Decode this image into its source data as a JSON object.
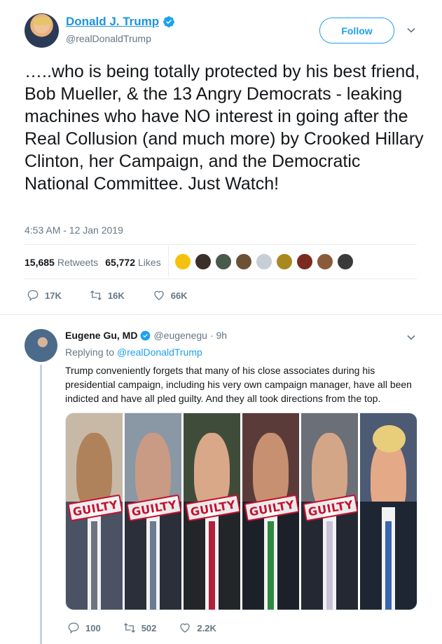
{
  "tweet": {
    "author_name": "Donald J. Trump",
    "handle": "@realDonaldTrump",
    "follow_label": "Follow",
    "text": "…..who is being totally protected by his best friend, Bob Mueller, & the 13 Angry Democrats - leaking machines who have NO interest in going after the Real Collusion (and much more) by Crooked Hillary Clinton, her Campaign, and the Democratic National Committee. Just Watch!",
    "timestamp": "4:53 AM - 12 Jan 2019",
    "retweets_count": "15,685",
    "retweets_label": "Retweets",
    "likes_count": "65,772",
    "likes_label": "Likes",
    "actions": {
      "replies": "17K",
      "retweets": "16K",
      "likes": "66K"
    }
  },
  "likers": [
    {
      "color": "#f4c20d",
      "icon": "emoji-avatar"
    },
    {
      "color": "#3b2f2a",
      "icon": "user-avatar"
    },
    {
      "color": "#4a5a4a",
      "icon": "user-avatar"
    },
    {
      "color": "#6b5234",
      "icon": "user-avatar"
    },
    {
      "color": "#c6ced6",
      "icon": "default-avatar"
    },
    {
      "color": "#a8891f",
      "icon": "user-avatar"
    },
    {
      "color": "#7a2a1e",
      "icon": "user-avatar"
    },
    {
      "color": "#8a5a3a",
      "icon": "user-avatar"
    },
    {
      "color": "#3a3a3a",
      "icon": "user-avatar"
    }
  ],
  "reply": {
    "author_name": "Eugene Gu, MD",
    "handle": "@eugenegu",
    "time": "· 9h",
    "replying_prefix": "Replying to",
    "replying_to": "@realDonaldTrump",
    "text": "Trump conveniently forgets that many of his close associates during his presidential campaign, including his very own campaign manager, have all been indicted and have all pled guilty. And they all took directions from the top.",
    "stamp_text": "GUILTY",
    "actions": {
      "replies": "100",
      "retweets": "502",
      "likes": "2.2K"
    }
  },
  "colors": {
    "accent": "#1da1f2",
    "name_link": "#1c94e0",
    "muted": "#657786",
    "stamp": "#c8102e"
  }
}
